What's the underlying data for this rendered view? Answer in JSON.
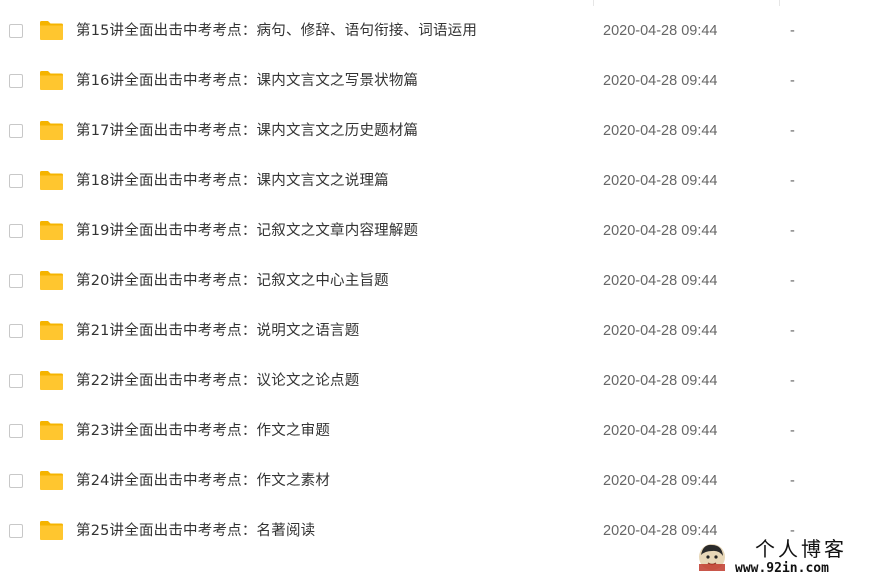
{
  "files": [
    {
      "name": "第15讲全面出击中考考点：病句、修辞、语句衔接、词语运用",
      "date": "2020-04-28 09:44",
      "size": "-"
    },
    {
      "name": "第16讲全面出击中考考点：课内文言文之写景状物篇",
      "date": "2020-04-28 09:44",
      "size": "-"
    },
    {
      "name": "第17讲全面出击中考考点：课内文言文之历史题材篇",
      "date": "2020-04-28 09:44",
      "size": "-"
    },
    {
      "name": "第18讲全面出击中考考点：课内文言文之说理篇",
      "date": "2020-04-28 09:44",
      "size": "-"
    },
    {
      "name": "第19讲全面出击中考考点：记叙文之文章内容理解题",
      "date": "2020-04-28 09:44",
      "size": "-"
    },
    {
      "name": "第20讲全面出击中考考点：记叙文之中心主旨题",
      "date": "2020-04-28 09:44",
      "size": "-"
    },
    {
      "name": "第21讲全面出击中考考点：说明文之语言题",
      "date": "2020-04-28 09:44",
      "size": "-"
    },
    {
      "name": "第22讲全面出击中考考点：议论文之论点题",
      "date": "2020-04-28 09:44",
      "size": "-"
    },
    {
      "name": "第23讲全面出击中考考点：作文之审题",
      "date": "2020-04-28 09:44",
      "size": "-"
    },
    {
      "name": "第24讲全面出击中考考点：作文之素材",
      "date": "2020-04-28 09:44",
      "size": "-"
    },
    {
      "name": "第25讲全面出击中考考点：名著阅读",
      "date": "2020-04-28 09:44",
      "size": "-"
    }
  ],
  "icons": {
    "row_checkbox": "checkbox-icon",
    "row_folder": "folder-icon",
    "watermark_avatar": "avatar-icon"
  },
  "colors": {
    "folder": "#ffc62f",
    "folder_tab": "#f5b400",
    "name_text": "#333333",
    "meta_text": "#666666"
  },
  "watermark": {
    "title": "个人博客",
    "url": "www.92in.com"
  }
}
